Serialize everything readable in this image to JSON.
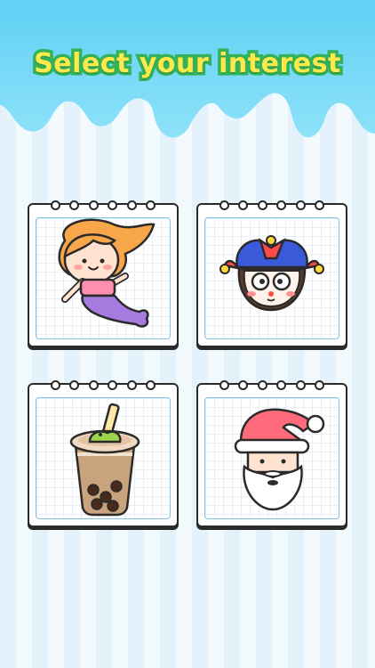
{
  "title": "Select your interest",
  "colors": {
    "sky": "#63d2f5",
    "title_fill": "#ffe94a",
    "title_stroke": "#33b25a",
    "card_border": "#2a2a2a",
    "inner_border": "#7fc4e6"
  },
  "cards": [
    {
      "name": "mermaid",
      "icon": "mermaid-icon"
    },
    {
      "name": "jester",
      "icon": "jester-icon"
    },
    {
      "name": "bubble-tea",
      "icon": "bubble-tea-icon"
    },
    {
      "name": "santa",
      "icon": "santa-icon"
    }
  ]
}
